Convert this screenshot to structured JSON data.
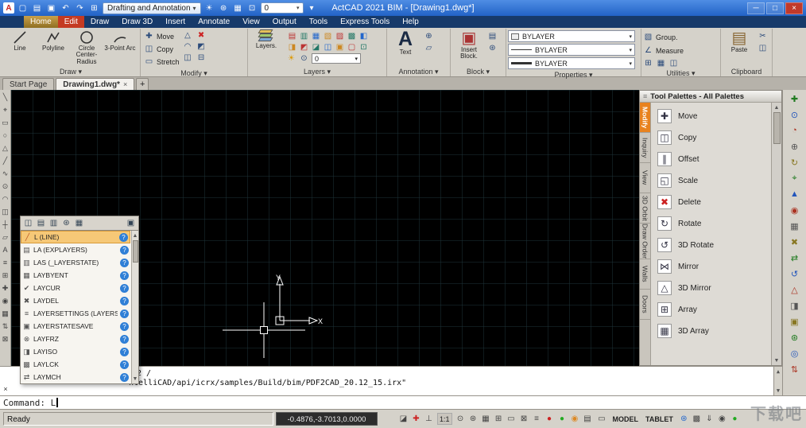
{
  "colors": {
    "title_bar_blue": "#2b6fd4",
    "tab_home_active": "#a57f2c",
    "tab_edit_red": "#c43a22",
    "selection_highlight": "#f6c877",
    "palette_tab_active": "#e8821e",
    "help_badge_blue": "#2f7fd6",
    "canvas_black": "#000000"
  },
  "glyphs": {
    "caret": "▾",
    "up": "▲",
    "down": "▼"
  },
  "title_bar": {
    "logo": "A",
    "quick_icons": [
      "▢",
      "▤",
      "▣",
      "↶",
      "↷",
      "⊞"
    ],
    "workspace": "Drafting and Annotation",
    "mid_icons": [
      "☀",
      "⊛",
      "▦",
      "⊡"
    ],
    "layer_value": "0",
    "overflow_caret": "▾",
    "title": "ActCAD 2021 BIM - [Drawing1.dwg*]",
    "min": "─",
    "max": "□",
    "close": "×"
  },
  "ribbon_tabs": [
    "Home",
    "Edit",
    "Draw",
    "Draw 3D",
    "Insert",
    "Annotate",
    "View",
    "Output",
    "Tools",
    "Express Tools",
    "Help"
  ],
  "ribbon": {
    "draw": {
      "label": "Draw",
      "tools": [
        "Line",
        "Polyline",
        "Circle Center-Radius",
        "3-Point Arc"
      ]
    },
    "modify": {
      "label": "Modify",
      "tools": [
        "Move",
        "Copy",
        "Stretch"
      ],
      "tool_icons": [
        "✚",
        "◫",
        "▭"
      ],
      "extra_icons": [
        "△",
        "◠",
        "◫"
      ],
      "delete_icon": "✖",
      "extra2": [
        "◩",
        "⊟"
      ]
    },
    "layers": {
      "label": "Layers",
      "button": "Layers.",
      "grid_icons": [
        "▤",
        "▥",
        "▦",
        "▧",
        "▨",
        "▩",
        "◧",
        "◨",
        "◩",
        "◪",
        "◫",
        "▣",
        "▢",
        "⊡"
      ],
      "bulb": "☀",
      "circle": "⊙",
      "layer_value": "0"
    },
    "annotation": {
      "label": "Annotation",
      "big": "A",
      "button": "Text",
      "extra_icons": [
        "⊕",
        "▱"
      ]
    },
    "block": {
      "label": "Block",
      "big": "▣",
      "button": "Insert Block.",
      "extra_icons": [
        "▤",
        "⊛"
      ]
    },
    "properties": {
      "label": "Properties",
      "rows": [
        {
          "value": "BYLAYER"
        },
        {
          "value": "BYLAYER"
        },
        {
          "value": "BYLAYER"
        }
      ]
    },
    "utilities": {
      "label": "Utilities",
      "tools": [
        {
          "icon": "▧",
          "label": "Group."
        },
        {
          "icon": "∠",
          "label": "Measure"
        }
      ],
      "extra_icons": [
        "⊞",
        "▦",
        "◫"
      ]
    },
    "clipboard": {
      "label": "Clipboard",
      "big": "▤",
      "button": "Paste",
      "extra_icons": [
        "✂",
        "◫"
      ]
    }
  },
  "doc_tabs": {
    "tabs": [
      {
        "label": "Start Page"
      },
      {
        "label": "Drawing1.dwg*"
      }
    ],
    "close": "×",
    "add": "+"
  },
  "left_toolbar": {
    "icons": [
      "╲",
      "⌖",
      "▭",
      "○",
      "△",
      "╱",
      "∿",
      "⊙",
      "◠",
      "◫",
      "┼",
      "▱",
      "A",
      "≡",
      "⊞",
      "✚",
      "◉",
      "▦",
      "⇅",
      "⊠"
    ]
  },
  "right_toolbar": {
    "icons": [
      "✚",
      "⊙",
      "◔",
      "⊕",
      "↻",
      "⌖",
      "▲",
      "◉",
      "▦",
      "✖",
      "⇄",
      "↺",
      "△",
      "◨",
      "▣",
      "⊛",
      "◎",
      "⇅"
    ]
  },
  "drawing": {
    "ucs_x": "X",
    "ucs_y": "Y"
  },
  "command_popup": {
    "toolbar_icons": [
      "◫",
      "▤",
      "▥",
      "⊛",
      "▦"
    ],
    "toolbar_icon_right": "▣",
    "help": "?",
    "items": [
      {
        "icon": "╱",
        "label": "L (LINE)"
      },
      {
        "icon": "▤",
        "label": "LA (EXPLAYERS)"
      },
      {
        "icon": "▥",
        "label": "LAS (_LAYERSTATE)"
      },
      {
        "icon": "▦",
        "label": "LAYBYENT"
      },
      {
        "icon": "✔",
        "label": "LAYCUR"
      },
      {
        "icon": "✖",
        "label": "LAYDEL"
      },
      {
        "icon": "≡",
        "label": "LAYERSETTINGS (LAYERSTATE)"
      },
      {
        "icon": "▣",
        "label": "LAYERSTATESAVE"
      },
      {
        "icon": "⊗",
        "label": "LAYFRZ"
      },
      {
        "icon": "◨",
        "label": "LAYISO"
      },
      {
        "icon": "▩",
        "label": "LAYLCK"
      },
      {
        "icon": "⇄",
        "label": "LAYMCH"
      }
    ]
  },
  "tool_palettes": {
    "grip": "≡",
    "title": "Tool Palettes - All Palettes",
    "tabs": [
      {
        "label": "Modify"
      },
      {
        "label": "Inquiry"
      },
      {
        "label": "View"
      },
      {
        "label": "3D Orbit"
      },
      {
        "label": "Draw Order"
      },
      {
        "label": "Walls"
      },
      {
        "label": "Doors"
      }
    ],
    "items": [
      {
        "icon": "✚",
        "label": "Move"
      },
      {
        "icon": "◫",
        "label": "Copy"
      },
      {
        "icon": "∥",
        "label": "Offset"
      },
      {
        "icon": "◱",
        "label": "Scale"
      },
      {
        "icon": "✖",
        "label": "Delete"
      },
      {
        "icon": "↻",
        "label": "Rotate"
      },
      {
        "icon": "↺",
        "label": "3D Rotate"
      },
      {
        "icon": "⋈",
        "label": "Mirror"
      },
      {
        "icon": "△",
        "label": "3D Mirror"
      },
      {
        "icon": "⊞",
        "label": "Array"
      },
      {
        "icon": "▦",
        "label": "3D Array"
      }
    ]
  },
  "command_area": {
    "history_line1": "2 /",
    "history_line2": "ntelliCAD/api/icrx/samples/Build/bim/PDF2CAD_20.12_15.irx\"",
    "prompt": "Command: L",
    "close": "×"
  },
  "status_bar": {
    "ready": "Ready",
    "coordinates": "-0.4876,-3.7013,0.0000",
    "group1": [
      "◪",
      "✚",
      "⊥"
    ],
    "scale": "1:1",
    "group2": [
      "⊙",
      "⊛",
      "▦",
      "⊞",
      "▭",
      "⊠",
      "≡",
      "●",
      "●",
      "◉",
      "▤"
    ],
    "model_icon": "▭",
    "model": "MODEL",
    "tablet": "TABLET",
    "group3": [
      "⊛",
      "▩",
      "⇓",
      "◉",
      "●"
    ]
  },
  "watermark": "下载吧"
}
